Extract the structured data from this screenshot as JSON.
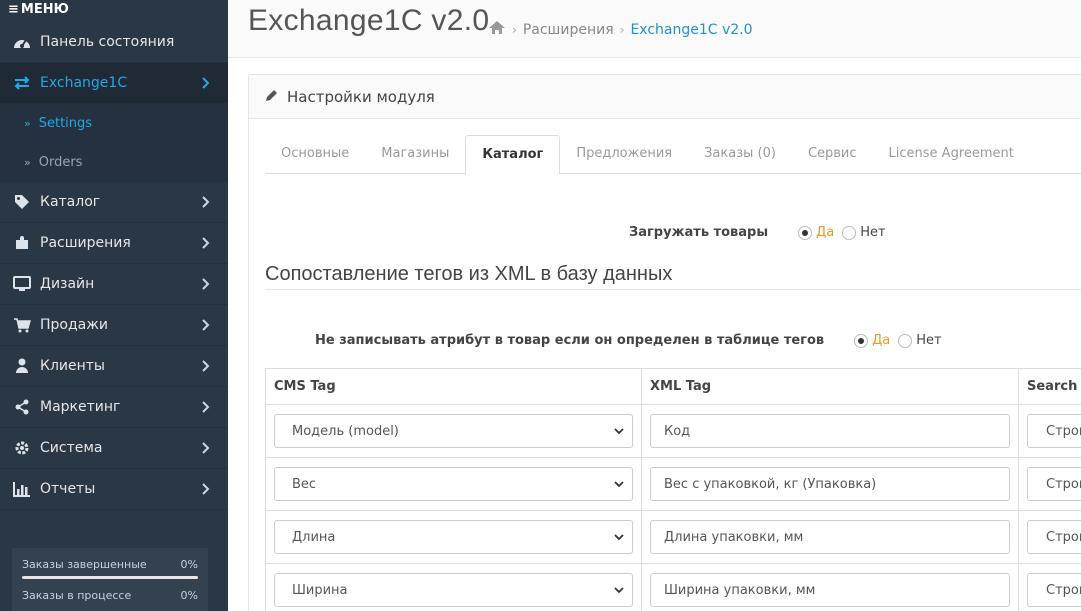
{
  "sidebar": {
    "menu_label": "МЕНЮ",
    "items": [
      {
        "label": "Панель состояния",
        "icon": "dashboard-icon"
      },
      {
        "label": "Exchange1C",
        "icon": "exchange-icon"
      },
      {
        "label": "Каталог",
        "icon": "tag-icon"
      },
      {
        "label": "Расширения",
        "icon": "puzzle-icon"
      },
      {
        "label": "Дизайн",
        "icon": "monitor-icon"
      },
      {
        "label": "Продажи",
        "icon": "cart-icon"
      },
      {
        "label": "Клиенты",
        "icon": "user-icon"
      },
      {
        "label": "Маркетинг",
        "icon": "share-icon"
      },
      {
        "label": "Система",
        "icon": "gear-icon"
      },
      {
        "label": "Отчеты",
        "icon": "bar-chart-icon"
      }
    ],
    "subitems": [
      {
        "label": "Settings"
      },
      {
        "label": "Orders"
      }
    ],
    "stats": [
      {
        "label": "Заказы завершенные",
        "value": "0%",
        "fraction": 0
      },
      {
        "label": "Заказы в процессе",
        "value": "0%",
        "fraction": 0
      }
    ]
  },
  "header": {
    "title": "Exchange1C v2.0",
    "breadcrumb": [
      "Расширения",
      "Exchange1C v2.0"
    ]
  },
  "panel": {
    "heading": "Настройки модуля",
    "tabs": [
      "Основные",
      "Магазины",
      "Каталог",
      "Предложения",
      "Заказы (0)",
      "Сервис",
      "License Agreement"
    ],
    "active_tab": "Каталог"
  },
  "settings": {
    "load_products": {
      "label": "Загружать товары",
      "yes": "Да",
      "no": "Нет"
    },
    "section_title": "Сопоставление тегов из XML в базу данных",
    "no_write_attr": {
      "label": "Не записывать атрибут в товар если он определен в таблице тегов",
      "yes": "Да",
      "no": "Нет"
    }
  },
  "table": {
    "headers": [
      "CMS Tag",
      "XML Tag",
      "Search t"
    ],
    "rows": [
      {
        "cms": "Модель (model)",
        "xml": "Код",
        "search": "Строг"
      },
      {
        "cms": "Вес",
        "xml": "Вес с упаковкой, кг (Упаковка)",
        "search": "Строг"
      },
      {
        "cms": "Длина",
        "xml": "Длина упаковки, мм",
        "search": "Строг"
      },
      {
        "cms": "Ширина",
        "xml": "Ширина упаковки, мм",
        "search": "Строг"
      }
    ]
  },
  "colors": {
    "sidebar_bg": "#2a3744",
    "accent": "#1e91cf",
    "radio_yes": "#e69a28"
  }
}
